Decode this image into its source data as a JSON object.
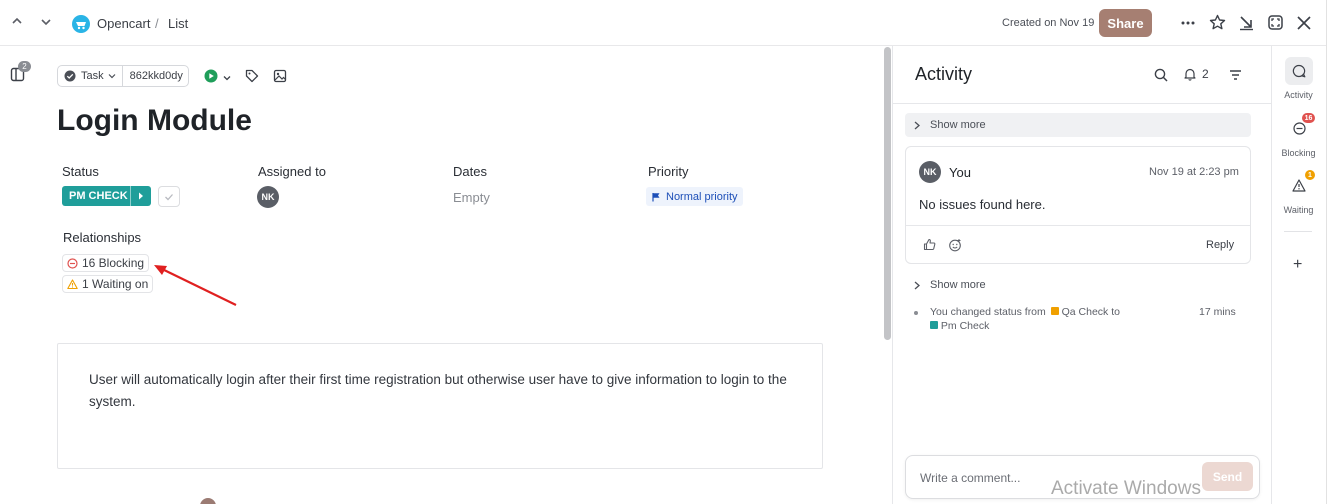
{
  "header": {
    "breadcrumb_workspace": "Opencart",
    "breadcrumb_separator": "/",
    "breadcrumb_list": "List",
    "created_text": "Created on Nov 19",
    "share_label": "Share"
  },
  "sidebar_badge": "2",
  "task": {
    "type_label": "Task",
    "id": "862kkd0dy",
    "title": "Login Module"
  },
  "fields": {
    "status_label": "Status",
    "status_value": "PM CHECK",
    "assigned_label": "Assigned to",
    "assignee_initials": "NK",
    "dates_label": "Dates",
    "dates_value": "Empty",
    "priority_label": "Priority",
    "priority_value": "Normal priority"
  },
  "relationships": {
    "label": "Relationships",
    "blocking": "16 Blocking",
    "waiting": "1 Waiting on"
  },
  "description": "User will automatically login after their first time registration but otherwise user have to give information to login to the system.",
  "activity": {
    "title": "Activity",
    "notif_count": "2",
    "show_more_1": "Show more",
    "comment_author_initials": "NK",
    "comment_author": "You",
    "comment_time": "Nov 19 at 2:23 pm",
    "comment_text": "No issues found here.",
    "reply_label": "Reply",
    "show_more_2": "Show more",
    "change_prefix": "You changed status from",
    "change_from": "Qa Check",
    "change_to_word": "to",
    "change_to": "Pm Check",
    "change_time": "17 mins",
    "comment_placeholder": "Write a comment...",
    "send_label": "Send"
  },
  "rail": {
    "activity_label": "Activity",
    "blocking_label": "Blocking",
    "blocking_badge": "16",
    "waiting_label": "Waiting",
    "waiting_badge": "1",
    "add_label": "+"
  },
  "watermark": "Activate Windows",
  "colors": {
    "status_teal": "#1f9e9a",
    "share_brown": "#a67f72",
    "priority_blue": "#1d4fb8",
    "blocking_red": "#e0524f",
    "waiting_orange": "#f0a000",
    "annotation_arrow": "#e02020"
  },
  "icons": [
    "chevron-up-icon",
    "chevron-down-icon",
    "opencart-logo-icon",
    "more-icon",
    "star-icon",
    "collapse-icon",
    "fullscreen-icon",
    "close-icon",
    "sidebar-icon",
    "check-circle-icon",
    "play-icon",
    "tag-icon",
    "image-icon",
    "flag-icon",
    "search-icon",
    "bell-icon",
    "filter-icon",
    "thumbs-up-icon",
    "emoji-icon",
    "chat-icon",
    "blocking-icon",
    "warning-icon",
    "plus-icon"
  ]
}
